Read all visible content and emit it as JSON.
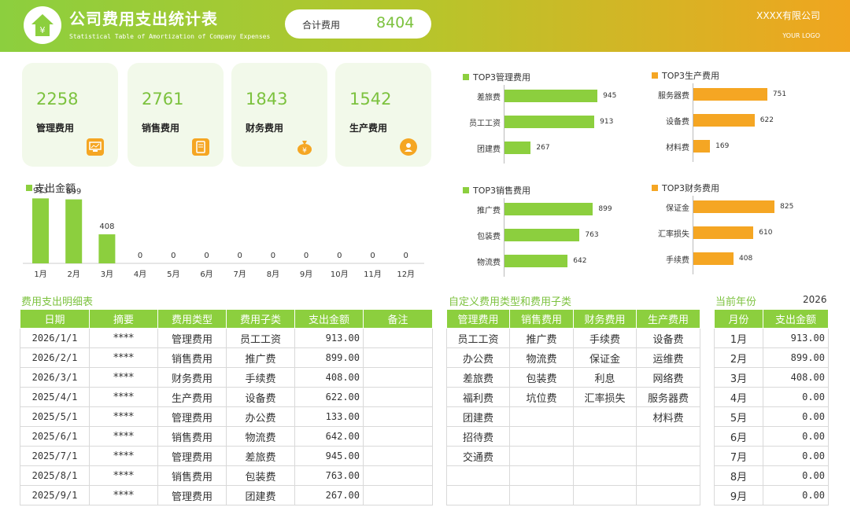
{
  "header": {
    "title": "公司费用支出统计表",
    "subtitle": "Statistical Table of Amortization of Company Expenses",
    "total_label": "合计费用",
    "total_value": "8404",
    "company": "XXXX有限公司",
    "your_logo": "YOUR LOGO",
    "logo_icon": "house-yuan-icon"
  },
  "kpis": [
    {
      "value": "2258",
      "label": "管理费用",
      "icon": "computer-icon",
      "color": "#f5a623"
    },
    {
      "value": "2761",
      "label": "销售费用",
      "icon": "tablet-icon",
      "color": "#f5a623"
    },
    {
      "value": "1843",
      "label": "财务费用",
      "icon": "money-bag-icon",
      "color": "#f5a623"
    },
    {
      "value": "1542",
      "label": "生产费用",
      "icon": "person-icon",
      "color": "#f5a623"
    }
  ],
  "chart_data": [
    {
      "type": "bar",
      "title": "支出金额",
      "categories": [
        "1月",
        "2月",
        "3月",
        "4月",
        "5月",
        "6月",
        "7月",
        "8月",
        "9月",
        "10月",
        "11月",
        "12月"
      ],
      "values": [
        913,
        899,
        408,
        0,
        0,
        0,
        0,
        0,
        0,
        0,
        0,
        0
      ],
      "data_labels": [
        "913",
        "899",
        "408",
        "0",
        "0",
        "0",
        "0",
        "0",
        "0",
        "0",
        "0",
        "0"
      ],
      "color": "#8ccf3e",
      "legend": "top-left"
    },
    {
      "type": "bar",
      "orientation": "horizontal",
      "title": "TOP3管理费用",
      "categories": [
        "差旅费",
        "员工工资",
        "团建费"
      ],
      "values": [
        945,
        913,
        267
      ],
      "color": "#8ccf3e"
    },
    {
      "type": "bar",
      "orientation": "horizontal",
      "title": "TOP3生产费用",
      "categories": [
        "服务器费",
        "设备费",
        "材料费"
      ],
      "values": [
        751,
        622,
        169
      ],
      "color": "#f5a623"
    },
    {
      "type": "bar",
      "orientation": "horizontal",
      "title": "TOP3销售费用",
      "categories": [
        "推广费",
        "包装费",
        "物流费"
      ],
      "values": [
        899,
        763,
        642
      ],
      "color": "#8ccf3e"
    },
    {
      "type": "bar",
      "orientation": "horizontal",
      "title": "TOP3财务费用",
      "categories": [
        "保证金",
        "汇率损失",
        "手续费"
      ],
      "values": [
        825,
        610,
        408
      ],
      "color": "#f5a623"
    }
  ],
  "detail": {
    "title": "费用支出明细表",
    "headers": [
      "日期",
      "摘要",
      "费用类型",
      "费用子类",
      "支出金额",
      "备注"
    ],
    "rows": [
      [
        "2026/1/1",
        "****",
        "管理费用",
        "员工工资",
        "913.00",
        ""
      ],
      [
        "2026/2/1",
        "****",
        "销售费用",
        "推广费",
        "899.00",
        ""
      ],
      [
        "2026/3/1",
        "****",
        "财务费用",
        "手续费",
        "408.00",
        ""
      ],
      [
        "2025/4/1",
        "****",
        "生产费用",
        "设备费",
        "622.00",
        ""
      ],
      [
        "2025/5/1",
        "****",
        "管理费用",
        "办公费",
        "133.00",
        ""
      ],
      [
        "2025/6/1",
        "****",
        "销售费用",
        "物流费",
        "642.00",
        ""
      ],
      [
        "2025/7/1",
        "****",
        "管理费用",
        "差旅费",
        "945.00",
        ""
      ],
      [
        "2025/8/1",
        "****",
        "销售费用",
        "包装费",
        "763.00",
        ""
      ],
      [
        "2025/9/1",
        "****",
        "管理费用",
        "团建费",
        "267.00",
        ""
      ]
    ]
  },
  "custom": {
    "title": "自定义费用类型和费用子类",
    "headers": [
      "管理费用",
      "销售费用",
      "财务费用",
      "生产费用"
    ],
    "rows": [
      [
        "员工工资",
        "推广费",
        "手续费",
        "设备费"
      ],
      [
        "办公费",
        "物流费",
        "保证金",
        "运维费"
      ],
      [
        "差旅费",
        "包装费",
        "利息",
        "网络费"
      ],
      [
        "福利费",
        "坑位费",
        "汇率损失",
        "服务器费"
      ],
      [
        "团建费",
        "",
        "",
        "材料费"
      ],
      [
        "招待费",
        "",
        "",
        ""
      ],
      [
        "交通费",
        "",
        "",
        ""
      ],
      [
        "",
        "",
        "",
        ""
      ],
      [
        "",
        "",
        "",
        ""
      ]
    ]
  },
  "year": {
    "title": "当前年份",
    "value": "2026",
    "headers": [
      "月份",
      "支出金额"
    ],
    "rows": [
      [
        "1月",
        "913.00"
      ],
      [
        "2月",
        "899.00"
      ],
      [
        "3月",
        "408.00"
      ],
      [
        "4月",
        "0.00"
      ],
      [
        "5月",
        "0.00"
      ],
      [
        "6月",
        "0.00"
      ],
      [
        "7月",
        "0.00"
      ],
      [
        "8月",
        "0.00"
      ],
      [
        "9月",
        "0.00"
      ]
    ]
  }
}
